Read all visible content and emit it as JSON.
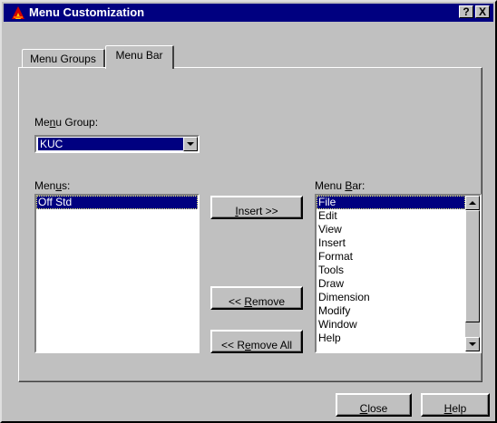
{
  "window": {
    "title": "Menu Customization",
    "help_btn": "?",
    "close_btn": "X"
  },
  "tabs": [
    {
      "label": "Menu Groups"
    },
    {
      "label": "Menu Bar"
    }
  ],
  "menu_group": {
    "label_pre": "Me",
    "label_u": "n",
    "label_post": "u Group:",
    "value": "KUC"
  },
  "menus": {
    "label_pre": "Men",
    "label_u": "u",
    "label_post": "s:",
    "items": [
      "Off Std"
    ]
  },
  "menu_bar": {
    "label_pre": "Menu ",
    "label_u": "B",
    "label_post": "ar:",
    "items": [
      "File",
      "Edit",
      "View",
      "Insert",
      "Format",
      "Tools",
      "Draw",
      "Dimension",
      "Modify",
      "Window",
      "Help"
    ]
  },
  "buttons": {
    "insert": {
      "u": "I",
      "rest": "nsert >>"
    },
    "remove": {
      "pre": "<< ",
      "u": "R",
      "rest": "emove"
    },
    "remove_all": {
      "pre": "<< R",
      "u": "e",
      "rest": "move All"
    },
    "close": {
      "u": "C",
      "rest": "lose"
    },
    "help": {
      "u": "H",
      "rest": "elp"
    }
  }
}
